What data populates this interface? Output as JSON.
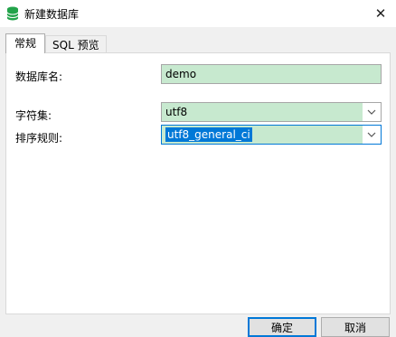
{
  "window": {
    "title": "新建数据库",
    "close_glyph": "✕"
  },
  "tabs": [
    {
      "label": "常规",
      "active": true
    },
    {
      "label": "SQL 预览",
      "active": false
    }
  ],
  "form": {
    "db_name_label": "数据库名:",
    "db_name_value": "demo",
    "charset_label": "字符集:",
    "charset_value": "utf8",
    "collation_label": "排序规则:",
    "collation_value": "utf8_general_ci"
  },
  "buttons": {
    "ok_label": "确定",
    "cancel_label": "取消"
  },
  "colors": {
    "field_bg": "#c7e9cf",
    "focus_border": "#0078d7",
    "selection": "#0078d7",
    "app_icon": "#22a34a"
  },
  "icons": {
    "app": "database-icon",
    "close": "close-icon",
    "dropdown": "chevron-down-icon"
  }
}
